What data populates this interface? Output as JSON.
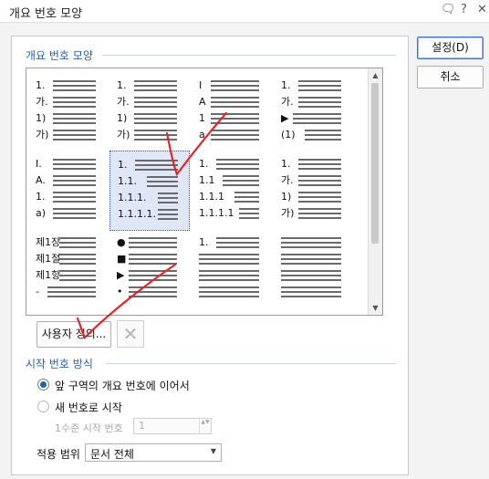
{
  "window": {
    "title": "개요 번호 모양",
    "title_icons": [
      "chat-icon",
      "help-icon",
      "close-icon"
    ],
    "title_icon_glyphs": [
      "🗨",
      "?",
      "✕"
    ]
  },
  "buttons": {
    "ok": "설정(D)",
    "cancel": "취소",
    "custom": "사용자 정의...",
    "delete_glyph": "✕"
  },
  "style_group": {
    "label": "개요 번호 모양"
  },
  "styles": [
    [
      [
        "1.",
        "가.",
        "1)",
        "가)"
      ],
      [
        "1.",
        "가.",
        "1)",
        "가)"
      ],
      [
        "I",
        "A",
        "1",
        "a"
      ],
      [
        "1.",
        "가.",
        "▶",
        "(1)"
      ]
    ],
    [
      [
        "I.",
        "A.",
        "1.",
        "a)"
      ],
      [
        "1.",
        "1.1.",
        "1.1.1.",
        "1.1.1.1."
      ],
      [
        "1.",
        "1.1",
        "1.1.1",
        "1.1.1.1"
      ],
      [
        "1.",
        "가.",
        "1)",
        "가)"
      ]
    ],
    [
      [
        "제1장",
        "제1절",
        "제1항",
        "-"
      ],
      [
        "●",
        "■",
        "▶",
        "•"
      ],
      [
        "1.",
        "",
        "",
        ""
      ],
      [
        "",
        "",
        "",
        ""
      ]
    ]
  ],
  "start_group": {
    "label": "시작 번호 방식"
  },
  "radio_continue": "앞 구역의 개요 번호에 이어서",
  "radio_new": "새 번호로 시작",
  "level_label": "1수준 시작 번호",
  "level_value": "1",
  "apply_label": "적용 범위",
  "apply_value": "문서 전체",
  "icons": {
    "scroll_up": "▲",
    "scroll_down": "▼",
    "spin": "▲▼",
    "dropdown": "▼"
  },
  "colors": {
    "accent": "#2a5db0",
    "selection": "#dfe6f6",
    "annotation": "#e0262a"
  }
}
